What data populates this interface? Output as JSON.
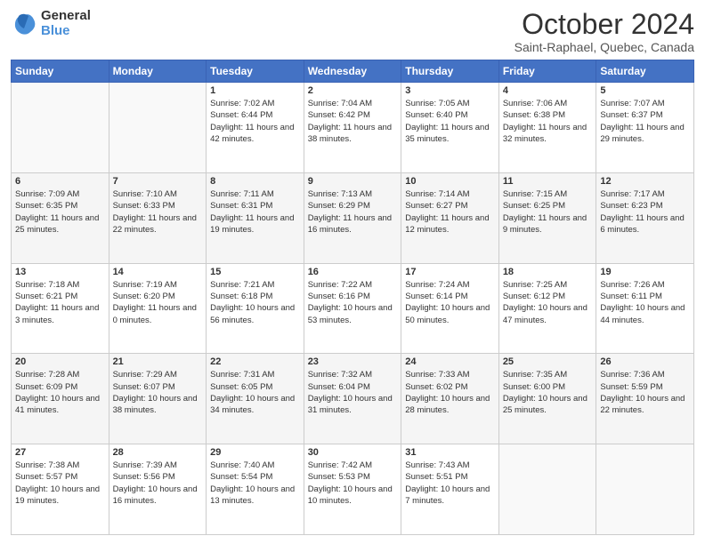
{
  "header": {
    "logo_general": "General",
    "logo_blue": "Blue",
    "title": "October 2024",
    "location": "Saint-Raphael, Quebec, Canada"
  },
  "weekdays": [
    "Sunday",
    "Monday",
    "Tuesday",
    "Wednesday",
    "Thursday",
    "Friday",
    "Saturday"
  ],
  "weeks": [
    [
      {
        "day": "",
        "content": ""
      },
      {
        "day": "",
        "content": ""
      },
      {
        "day": "1",
        "content": "Sunrise: 7:02 AM\nSunset: 6:44 PM\nDaylight: 11 hours and 42 minutes."
      },
      {
        "day": "2",
        "content": "Sunrise: 7:04 AM\nSunset: 6:42 PM\nDaylight: 11 hours and 38 minutes."
      },
      {
        "day": "3",
        "content": "Sunrise: 7:05 AM\nSunset: 6:40 PM\nDaylight: 11 hours and 35 minutes."
      },
      {
        "day": "4",
        "content": "Sunrise: 7:06 AM\nSunset: 6:38 PM\nDaylight: 11 hours and 32 minutes."
      },
      {
        "day": "5",
        "content": "Sunrise: 7:07 AM\nSunset: 6:37 PM\nDaylight: 11 hours and 29 minutes."
      }
    ],
    [
      {
        "day": "6",
        "content": "Sunrise: 7:09 AM\nSunset: 6:35 PM\nDaylight: 11 hours and 25 minutes."
      },
      {
        "day": "7",
        "content": "Sunrise: 7:10 AM\nSunset: 6:33 PM\nDaylight: 11 hours and 22 minutes."
      },
      {
        "day": "8",
        "content": "Sunrise: 7:11 AM\nSunset: 6:31 PM\nDaylight: 11 hours and 19 minutes."
      },
      {
        "day": "9",
        "content": "Sunrise: 7:13 AM\nSunset: 6:29 PM\nDaylight: 11 hours and 16 minutes."
      },
      {
        "day": "10",
        "content": "Sunrise: 7:14 AM\nSunset: 6:27 PM\nDaylight: 11 hours and 12 minutes."
      },
      {
        "day": "11",
        "content": "Sunrise: 7:15 AM\nSunset: 6:25 PM\nDaylight: 11 hours and 9 minutes."
      },
      {
        "day": "12",
        "content": "Sunrise: 7:17 AM\nSunset: 6:23 PM\nDaylight: 11 hours and 6 minutes."
      }
    ],
    [
      {
        "day": "13",
        "content": "Sunrise: 7:18 AM\nSunset: 6:21 PM\nDaylight: 11 hours and 3 minutes."
      },
      {
        "day": "14",
        "content": "Sunrise: 7:19 AM\nSunset: 6:20 PM\nDaylight: 11 hours and 0 minutes."
      },
      {
        "day": "15",
        "content": "Sunrise: 7:21 AM\nSunset: 6:18 PM\nDaylight: 10 hours and 56 minutes."
      },
      {
        "day": "16",
        "content": "Sunrise: 7:22 AM\nSunset: 6:16 PM\nDaylight: 10 hours and 53 minutes."
      },
      {
        "day": "17",
        "content": "Sunrise: 7:24 AM\nSunset: 6:14 PM\nDaylight: 10 hours and 50 minutes."
      },
      {
        "day": "18",
        "content": "Sunrise: 7:25 AM\nSunset: 6:12 PM\nDaylight: 10 hours and 47 minutes."
      },
      {
        "day": "19",
        "content": "Sunrise: 7:26 AM\nSunset: 6:11 PM\nDaylight: 10 hours and 44 minutes."
      }
    ],
    [
      {
        "day": "20",
        "content": "Sunrise: 7:28 AM\nSunset: 6:09 PM\nDaylight: 10 hours and 41 minutes."
      },
      {
        "day": "21",
        "content": "Sunrise: 7:29 AM\nSunset: 6:07 PM\nDaylight: 10 hours and 38 minutes."
      },
      {
        "day": "22",
        "content": "Sunrise: 7:31 AM\nSunset: 6:05 PM\nDaylight: 10 hours and 34 minutes."
      },
      {
        "day": "23",
        "content": "Sunrise: 7:32 AM\nSunset: 6:04 PM\nDaylight: 10 hours and 31 minutes."
      },
      {
        "day": "24",
        "content": "Sunrise: 7:33 AM\nSunset: 6:02 PM\nDaylight: 10 hours and 28 minutes."
      },
      {
        "day": "25",
        "content": "Sunrise: 7:35 AM\nSunset: 6:00 PM\nDaylight: 10 hours and 25 minutes."
      },
      {
        "day": "26",
        "content": "Sunrise: 7:36 AM\nSunset: 5:59 PM\nDaylight: 10 hours and 22 minutes."
      }
    ],
    [
      {
        "day": "27",
        "content": "Sunrise: 7:38 AM\nSunset: 5:57 PM\nDaylight: 10 hours and 19 minutes."
      },
      {
        "day": "28",
        "content": "Sunrise: 7:39 AM\nSunset: 5:56 PM\nDaylight: 10 hours and 16 minutes."
      },
      {
        "day": "29",
        "content": "Sunrise: 7:40 AM\nSunset: 5:54 PM\nDaylight: 10 hours and 13 minutes."
      },
      {
        "day": "30",
        "content": "Sunrise: 7:42 AM\nSunset: 5:53 PM\nDaylight: 10 hours and 10 minutes."
      },
      {
        "day": "31",
        "content": "Sunrise: 7:43 AM\nSunset: 5:51 PM\nDaylight: 10 hours and 7 minutes."
      },
      {
        "day": "",
        "content": ""
      },
      {
        "day": "",
        "content": ""
      }
    ]
  ]
}
